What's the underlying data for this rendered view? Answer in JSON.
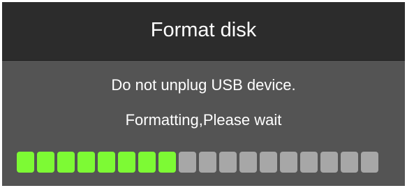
{
  "dialog": {
    "title": "Format disk",
    "message_line1": "Do not unplug USB device.",
    "message_line2": "Formatting,Please wait"
  },
  "progress": {
    "segments_total": 18,
    "segments_filled": 8,
    "fraction": 0.444
  },
  "colors": {
    "title_bar": "#2c2c2c",
    "dialog_body": "#545454",
    "progress_filled": "#7dfa34",
    "progress_empty": "#a7a7a7",
    "text": "#ffffff"
  }
}
